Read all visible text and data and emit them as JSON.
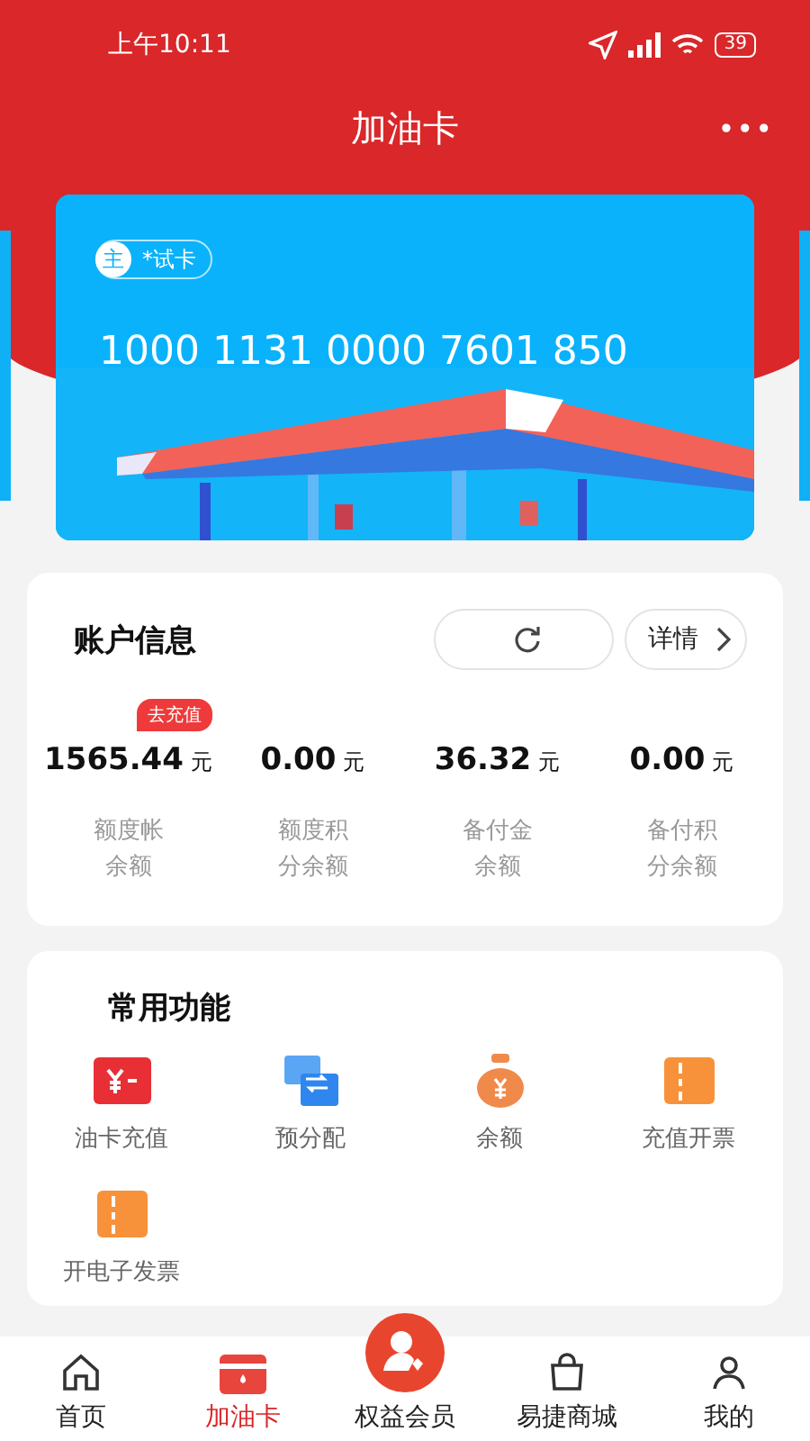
{
  "status_bar": {
    "time": "上午10:11",
    "battery": "39"
  },
  "header": {
    "title": "加油卡",
    "more": "•••"
  },
  "card": {
    "badge": "主",
    "name": "*试卡",
    "number": "1000 1131 0000 7601 850"
  },
  "account": {
    "title": "账户信息",
    "detail": "详情",
    "recharge_tag": "去充值",
    "balances": [
      {
        "amount": "1565.44",
        "unit": "元",
        "label_lines": [
          "额度帐",
          "余额"
        ]
      },
      {
        "amount": "0.00",
        "unit": "元",
        "label_lines": [
          "额度积",
          "分余额"
        ]
      },
      {
        "amount": "36.32",
        "unit": "元",
        "label_lines": [
          "备付金",
          "余额"
        ]
      },
      {
        "amount": "0.00",
        "unit": "元",
        "label_lines": [
          "备付积",
          "分余额"
        ]
      }
    ]
  },
  "functions": {
    "title": "常用功能",
    "items": [
      {
        "kind": "recharge",
        "label": "油卡充值"
      },
      {
        "kind": "allocate",
        "label": "预分配"
      },
      {
        "kind": "balance",
        "label": "余额"
      },
      {
        "kind": "invoice",
        "label": "充值开票"
      },
      {
        "kind": "invoice",
        "label": "开电子发票"
      }
    ]
  },
  "tabs": [
    {
      "kind": "home",
      "label": "首页",
      "selected": false
    },
    {
      "kind": "card",
      "label": "加油卡",
      "selected": true
    },
    {
      "kind": "member",
      "label": "权益会员",
      "selected": false
    },
    {
      "kind": "mall",
      "label": "易捷商城",
      "selected": false
    },
    {
      "kind": "me",
      "label": "我的",
      "selected": false
    }
  ]
}
